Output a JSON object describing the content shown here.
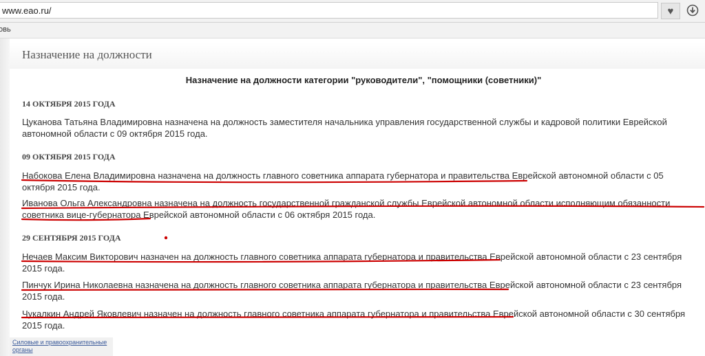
{
  "browser": {
    "url": "www.eao.ru/",
    "bookmark_fragment": "овь"
  },
  "page": {
    "title": "Назначение на должности",
    "subtitle": "Назначение на должности категории \"руководители\", \"помощники (советники)\""
  },
  "sections": [
    {
      "date": "14 ОКТЯБРЯ 2015 ГОДА",
      "entries": [
        "Цуканова Татьяна Владимировна назначена на должность заместителя начальника управления государственной службы и кадровой политики Еврейской автономной области с 09 октября 2015 года."
      ]
    },
    {
      "date": "09 ОКТЯБРЯ 2015 ГОДА",
      "entries": [
        "Набокова Елена Владимировна назначена на должность главного советника аппарата губернатора и правительства Еврейской автономной области с 05 октября 2015 года.",
        "Иванова Ольга Александровна назначена на должность государственной гражданской службы Еврейской автономной области исполняющим обязанности советника вице-губернатора Еврейской автономной области с 06 октября 2015 года."
      ]
    },
    {
      "date": "29 СЕНТЯБРЯ 2015 ГОДА",
      "entries": [
        "Нечаев Максим Викторович назначен на должность главного советника аппарата губернатора и правительства Еврейской автономной области с 23 сентября 2015 года.",
        "Пинчук Ирина Николаевна назначена на должность главного советника аппарата губернатора и правительства Еврейской автономной области с 23 сентября 2015 года.",
        "Чукалкин Андрей Яковлевич назначен на должность главного советника аппарата губернатора и правительства Еврейской автономной области с 30 сентября 2015 года."
      ]
    }
  ],
  "footer": {
    "link": "Силовые и правоохранительные органы"
  },
  "colors": {
    "annotation": "#cc0000",
    "link": "#3a5a9a"
  }
}
